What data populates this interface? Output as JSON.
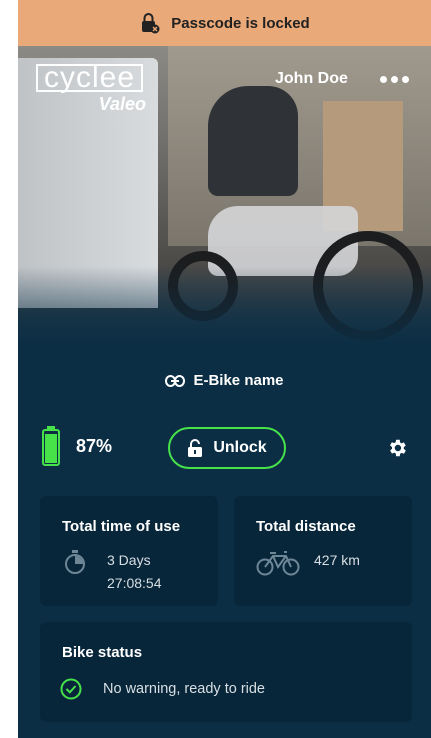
{
  "banner": {
    "text": "Passcode is locked"
  },
  "brand": {
    "name": "cyclee",
    "partner": "Valeo"
  },
  "header": {
    "user_name": "John Doe"
  },
  "bike": {
    "name": "E-Bike name"
  },
  "battery": {
    "percent": "87%",
    "level": 0.87,
    "color": "#47e24a"
  },
  "actions": {
    "unlock_label": "Unlock"
  },
  "stats": {
    "time": {
      "title": "Total time of use",
      "days": "3 Days",
      "hms": "27:08:54"
    },
    "distance": {
      "title": "Total distance",
      "value": "427 km"
    }
  },
  "status": {
    "title": "Bike status",
    "message": "No warning, ready to ride"
  },
  "colors": {
    "banner": "#e9a978",
    "background": "#0b2e45",
    "card": "#08263a",
    "accent_green": "#47e24a"
  }
}
